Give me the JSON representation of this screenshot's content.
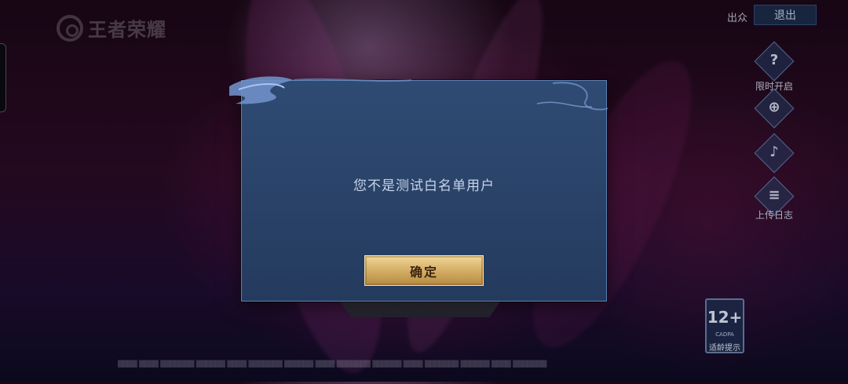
{
  "header": {
    "logo_text": "王者荣耀",
    "spectate_label": "出众",
    "exit_label": "退出"
  },
  "side_menu": {
    "items": [
      {
        "icon": "question-icon",
        "glyph": "?",
        "label": "限时开启"
      },
      {
        "icon": "gamepad-icon",
        "glyph": "⊕",
        "label": ""
      },
      {
        "icon": "speaker-icon",
        "glyph": "♪",
        "label": ""
      },
      {
        "icon": "clipboard-icon",
        "glyph": "≡",
        "label": "上传日志"
      }
    ]
  },
  "dialog": {
    "message": "您不是测试白名单用户",
    "confirm_label": "确定"
  },
  "age_rating": {
    "number": "12+",
    "org": "CADPA",
    "label": "适龄提示"
  },
  "colors": {
    "dialog_bg": "#2f4b73",
    "dialog_border": "#5c80b3",
    "button_gold": "#d8b26a",
    "exit_bg": "#1b2c48"
  }
}
